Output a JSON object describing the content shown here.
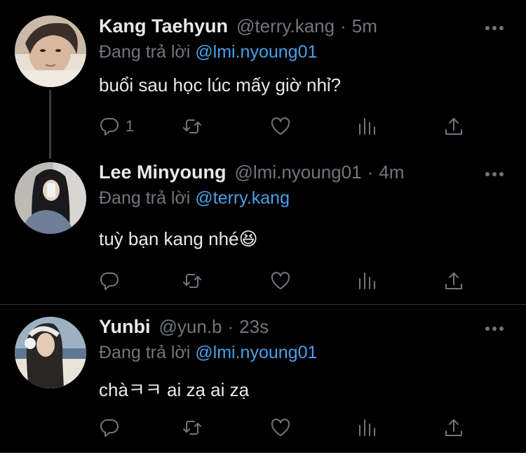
{
  "tweets": [
    {
      "name": "Kang Taehyun",
      "handle": "@terry.kang",
      "time": "5m",
      "reply_prefix": "Đang trả lời",
      "reply_to": "@lmi.nyoung01",
      "text": "buổi sau học lúc mấy giờ nhỉ?",
      "reply_count": "1",
      "avatar_icon": "avatar-photo"
    },
    {
      "name": "Lee Minyoung",
      "handle": "@lmi.nyoung01",
      "time": "4m",
      "reply_prefix": "Đang trả lời",
      "reply_to": "@terry.kang",
      "text": "tuỳ bạn kang nhé😆",
      "reply_count": "",
      "avatar_icon": "avatar-photo"
    },
    {
      "name": "Yunbi",
      "handle": "@yun.b",
      "time": "23s",
      "reply_prefix": "Đang trả lời",
      "reply_to": "@lmi.nyoung01",
      "text": "chàㅋㅋ ai zạ ai zạ",
      "reply_count": "",
      "avatar_icon": "avatar-photo"
    }
  ],
  "separator_dot": "·",
  "colors": {
    "background": "#000000",
    "primary_text": "#e7e9ea",
    "secondary_text": "#71767b",
    "mention": "#4a9fe8",
    "divider": "#2f3336"
  },
  "action_icons": [
    "reply-icon",
    "retweet-icon",
    "like-icon",
    "analytics-icon",
    "share-icon"
  ]
}
